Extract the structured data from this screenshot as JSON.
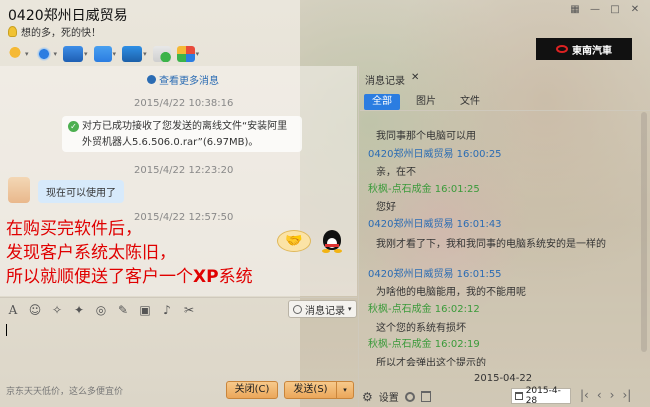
{
  "window": {
    "title": "0420郑州日威贸易",
    "signature": "想的多，死的快！",
    "brand": "東南汽車"
  },
  "chat": {
    "more_messages": "查看更多消息",
    "ts1": "2015/4/22 10:38:16",
    "sys_line1": "对方已成功接收了您发送的离线文件“安装阿里",
    "sys_line2": "外贸机器人5.6.506.0.rar”(6.97MB)。",
    "ts2": "2015/4/22 12:23:20",
    "bubble": "现在可以使用了",
    "ts3": "2015/4/22 12:57:50"
  },
  "overlay": {
    "line1": "在购买完软件后，",
    "line2": "发现客户系统太陈旧，",
    "line3a": "所以就顺便送了客户一个",
    "line3b": "XP",
    "line3c": "系统"
  },
  "input": {
    "history_button": "消息记录",
    "ad": "京东天天低价，这么多便宜价",
    "close_button": "关闭(C)",
    "send_button": "发送(S)"
  },
  "history_panel": {
    "title": "消息记录",
    "close": "✕",
    "tabs": [
      "全部",
      "图片",
      "文件"
    ],
    "entries": [
      {
        "type": "msg",
        "text": "我同事那个电脑可以用"
      },
      {
        "type": "sender_b",
        "text": "0420郑州日威贸易 16:00:25"
      },
      {
        "type": "msg",
        "text": "亲，在不"
      },
      {
        "type": "sender_g",
        "text": "秋枫-点石成金 16:01:25"
      },
      {
        "type": "msg",
        "text": "您好"
      },
      {
        "type": "sender_b",
        "text": "0420郑州日威贸易 16:01:43"
      },
      {
        "type": "msg",
        "text": "我刚才看了下，我和我同事的电脑系统安的是一样的"
      },
      {
        "type": "sender_b",
        "text": "0420郑州日威贸易 16:01:55"
      },
      {
        "type": "msg",
        "text": "为啥他的电脑能用，我的不能用呢"
      },
      {
        "type": "sender_g",
        "text": "秋枫-点石成金 16:02:12"
      },
      {
        "type": "msg",
        "text": "这个您的系统有损坏"
      },
      {
        "type": "sender_g",
        "text": "秋枫-点石成金 16:02:19"
      },
      {
        "type": "msg",
        "text": "所以才会弹出这个提示的"
      }
    ],
    "date": "2015-04-22",
    "settings": "设置",
    "date_box": "2015-4-28"
  }
}
